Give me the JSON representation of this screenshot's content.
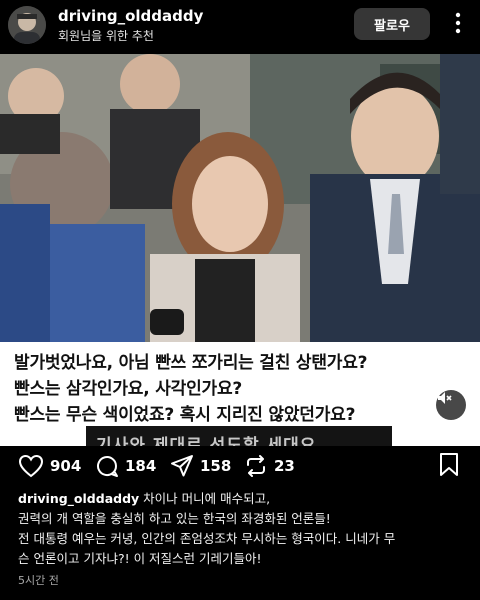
{
  "header": {
    "username": "driving_olddaddy",
    "subtitle": "회원님을 위한 추천",
    "follow_label": "팔로우",
    "more_icon": "more-dots-icon"
  },
  "media": {
    "caption_lines": [
      "발가벗었나요, 아님 빤쓰 쪼가리는 걸친 상탠가요?",
      "빤스는 삼각인가요, 사각인가요?",
      "빤스는 무슨 색이었죠? 혹시 지리진 않았던가요?"
    ],
    "subtitle_text": "기사와 제대로 선도할 세대요",
    "mute_icon": "speaker-muted-icon"
  },
  "actions": {
    "likes": "904",
    "comments": "184",
    "shares": "158",
    "reposts": "23"
  },
  "post": {
    "username": "driving_olddaddy",
    "lines": [
      "차이나 머니에 매수되고,",
      "권력의 개 역할을 충실히 하고 있는 한국의 좌경화된 언론들!",
      "전 대통령 예우는 커녕, 인간의 존엄성조차 무시하는 형국이다. 니네가 무",
      "슨 언론이고 기자냐?! 이 저질스런 기레기들아!"
    ],
    "time": "5시간 전"
  }
}
